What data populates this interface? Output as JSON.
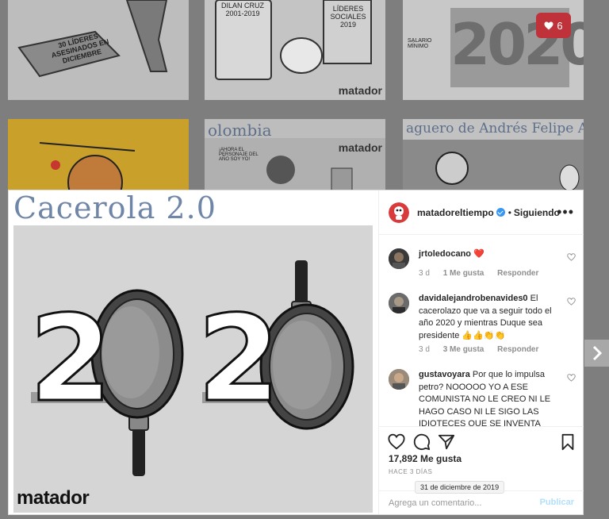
{
  "background_tiles": {
    "tile1_caption": "30 LÍDERES ASESINADOS EN DICIEMBRE",
    "tile2_caption": "DILAN CRUZ 2001-2019",
    "tile2_caption2": "LÍDERES SOCIALES 2019",
    "tile2_brand": "matador",
    "tile3_caption": "SALARIO MÍNIMO",
    "tile3_year": "2020",
    "tile5_caption": "olombia",
    "tile5_speech": "¡AHORA EL PERSONAJE DEL AÑO SOY YO!",
    "tile5_brand": "matador",
    "tile6_caption": "aguero de Andrés Felipe Arias",
    "likes_badge": "6"
  },
  "post": {
    "title": "Cacerola 2.0",
    "cartoon_brand": "matador",
    "cartoon_text": "2020"
  },
  "header": {
    "username": "matadoreltiempo",
    "separator": "•",
    "follow_label": "Siguiendo",
    "more_label": "•••"
  },
  "comments": [
    {
      "user": "jrtoledocano",
      "text": "❤️",
      "time": "3 d",
      "likes": "1 Me gusta",
      "reply": "Responder"
    },
    {
      "user": "davidalejandrobenavides0",
      "text": "El cacerolazo que va a seguir todo el año 2020 y mientras Duque sea presidente 👍👍👏👏",
      "time": "3 d",
      "likes": "3 Me gusta",
      "reply": "Responder"
    },
    {
      "user": "gustavoyara",
      "text": "Por que lo impulsa petro? NOOOOO YO A ESE COMUNISTA NO LE CREO NI LE HAGO CASO NI LE SIGO LAS IDIOTECES QUE SE INVENTA"
    }
  ],
  "actions": {
    "likes_count": "17,892 Me gusta",
    "posted_ago": "HACE 3 DÍAS",
    "date_tooltip": "31 de diciembre de 2019",
    "comment_placeholder": "Agrega un comentario...",
    "publish_label": "Publicar"
  },
  "colors": {
    "accent_blue": "#3897f0",
    "publish_disabled": "#b2dffc",
    "heart_red": "#ed4956",
    "title_blue": "#6f86a8"
  }
}
